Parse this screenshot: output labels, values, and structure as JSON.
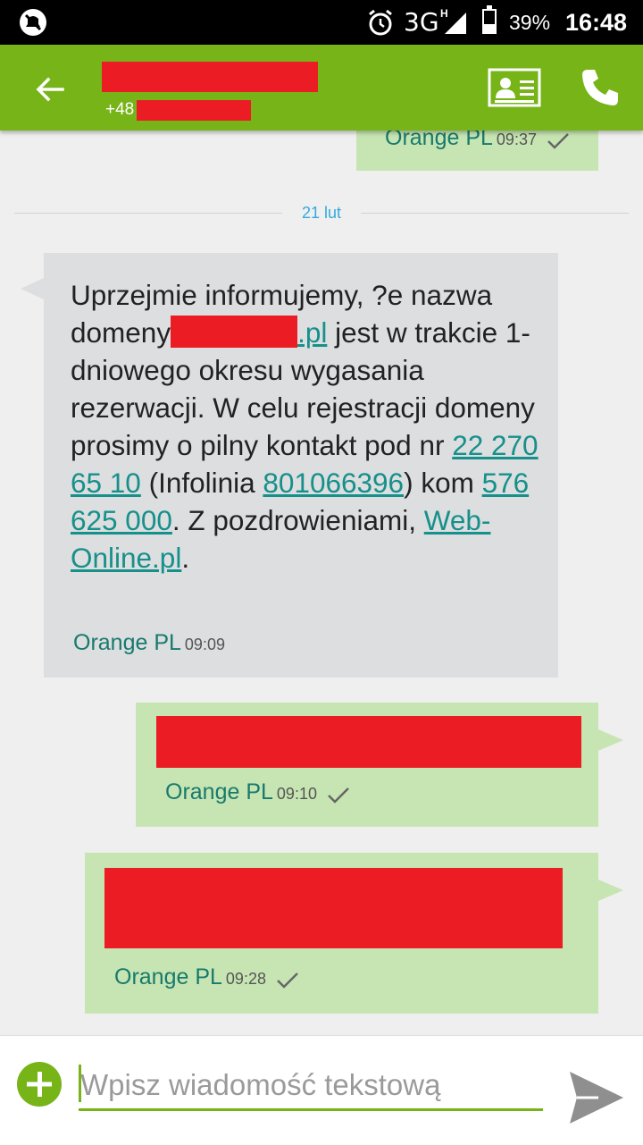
{
  "status_bar": {
    "network": "3G",
    "network_sup": "H",
    "battery_percent": "39%",
    "battery_level": 0.39,
    "time": "16:48",
    "icons": [
      "no-notifications-icon",
      "alarm-icon",
      "signal-icon",
      "battery-icon"
    ]
  },
  "header": {
    "contact_name": "",
    "number_prefix": "+48",
    "number_rest": "",
    "icons": [
      "back-arrow-icon",
      "contact-card-icon",
      "phone-icon"
    ]
  },
  "messages": {
    "top_partial": {
      "operator": "Orange PL",
      "time": "09:37"
    },
    "date_separator": "21 lut",
    "received": {
      "t1": "Uprzejmie informujemy, ?e nazwa domeny",
      "l_domain": ".pl",
      "t2": " jest w trakcie 1-dniowego okresu wygasania rezerwacji. W celu rejestracji domeny prosimy o pilny kontakt pod nr ",
      "l_phone1": "22 270 65 10",
      "t3": " (Infolinia ",
      "l_phone2": "801066396",
      "t4": ") kom ",
      "l_phone3": "576 625 000",
      "t5": ". Z pozdrowieniami, ",
      "l_site": "Web-Online.pl",
      "t6": ".",
      "operator": "Orange PL",
      "time": "09:09"
    },
    "sent1": {
      "operator": "Orange PL",
      "time": "09:10"
    },
    "sent2": {
      "operator": "Orange PL",
      "time": "09:28"
    }
  },
  "composer": {
    "placeholder": "Wpisz wiadomość tekstową",
    "icons": [
      "add-icon",
      "send-icon"
    ]
  },
  "colors": {
    "accent": "#76b418",
    "sent_bubble": "#c7e5b2",
    "received_bubble": "#dcdee0",
    "link": "#16908a",
    "redaction": "#ec1c24",
    "date_label": "#33aadd"
  }
}
